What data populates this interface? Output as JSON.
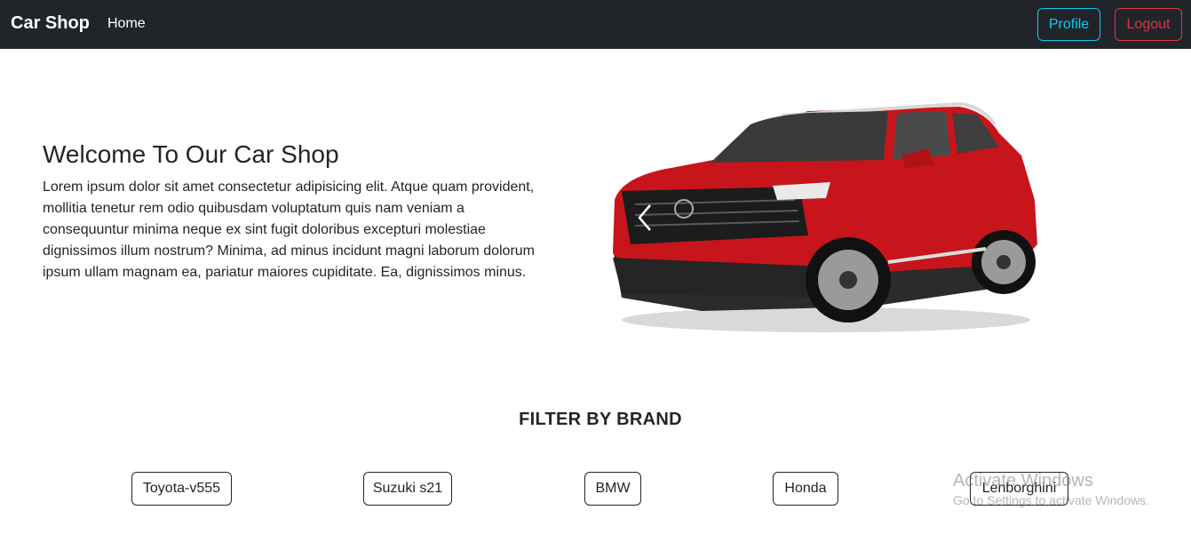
{
  "navbar": {
    "brand": "Car Shop",
    "home": "Home",
    "profile": "Profile",
    "logout": "Logout"
  },
  "hero": {
    "title": "Welcome To Our Car Shop",
    "text": "Lorem ipsum dolor sit amet consectetur adipisicing elit. Atque quam provident, mollitia tenetur rem odio quibusdam voluptatum quis nam veniam a consequuntur minima neque ex sint fugit doloribus excepturi molestiae dignissimos illum nostrum? Minima, ad minus incidunt magni laborum dolorum ipsum ullam magnam ea, pariatur maiores cupiditate. Ea, dignissimos minus."
  },
  "carousel": {
    "prev_icon": "chevron-left-icon",
    "car_color": "#c8141b"
  },
  "filter": {
    "title": "FILTER BY BRAND",
    "brands": [
      "Toyota-v555",
      "Suzuki s21",
      "BMW",
      "Honda",
      "Lenborghini"
    ]
  },
  "watermark": {
    "title": "Activate Windows",
    "subtitle": "Go to Settings to activate Windows."
  },
  "colors": {
    "navbar_bg": "#212529",
    "profile_accent": "#0dcaf0",
    "logout_accent": "#dc3545"
  }
}
